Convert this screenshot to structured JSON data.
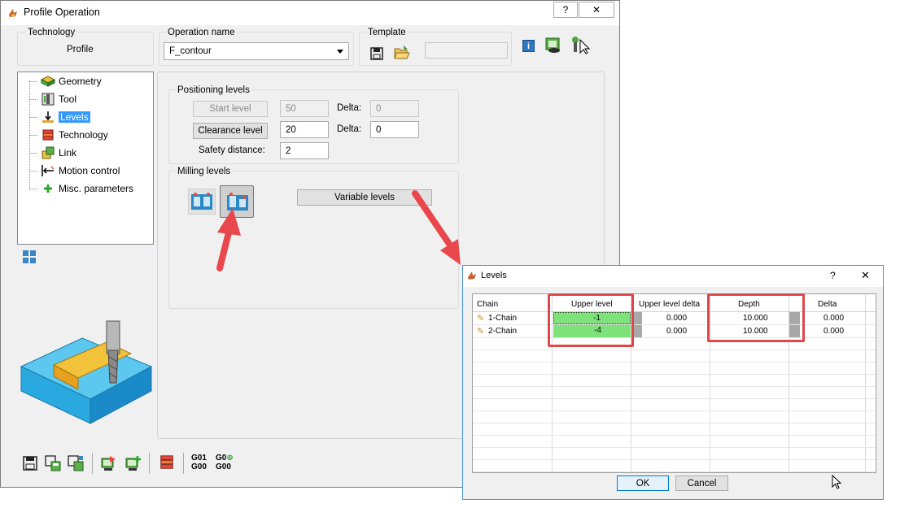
{
  "main": {
    "title": "Profile Operation",
    "help_btn": "?",
    "close_btn": "✕",
    "technology": {
      "label": "Technology",
      "value": "Profile"
    },
    "operation_name": {
      "label": "Operation name",
      "value": "F_contour"
    },
    "template": {
      "label": "Template"
    },
    "tree": {
      "items": [
        {
          "label": "Geometry"
        },
        {
          "label": "Tool"
        },
        {
          "label": "Levels"
        },
        {
          "label": "Technology"
        },
        {
          "label": "Link"
        },
        {
          "label": "Motion control"
        },
        {
          "label": "Misc. parameters"
        }
      ]
    },
    "positioning": {
      "label": "Positioning levels",
      "start_level_btn": "Start level",
      "start_level_value": "50",
      "start_delta_label": "Delta:",
      "start_delta_value": "0",
      "clearance_level_btn": "Clearance level",
      "clearance_level_value": "20",
      "clearance_delta_label": "Delta:",
      "clearance_delta_value": "0",
      "safety_label": "Safety distance:",
      "safety_value": "2"
    },
    "milling": {
      "label": "Milling levels",
      "variable_levels_btn": "Variable levels"
    },
    "toolbar": {
      "g01": "G01",
      "g00a": "G00",
      "g0": "G0",
      "g00b": "G00"
    }
  },
  "levels_dialog": {
    "title": "Levels",
    "help_btn": "?",
    "close_btn": "✕",
    "columns": [
      "Chain",
      "Upper level",
      "Upper level delta",
      "Depth",
      "Delta"
    ],
    "rows": [
      {
        "chain": "1-Chain",
        "upper_level": "-1",
        "upper_level_delta": "0.000",
        "depth": "10.000",
        "delta": "0.000"
      },
      {
        "chain": "2-Chain",
        "upper_level": "-4",
        "upper_level_delta": "0.000",
        "depth": "10.000",
        "delta": "0.000"
      }
    ],
    "ok_btn": "OK",
    "cancel_btn": "Cancel"
  },
  "colors": {
    "accent_red": "#e0474c",
    "highlight_green": "#7ee27a",
    "selection_blue": "#3399ff"
  }
}
